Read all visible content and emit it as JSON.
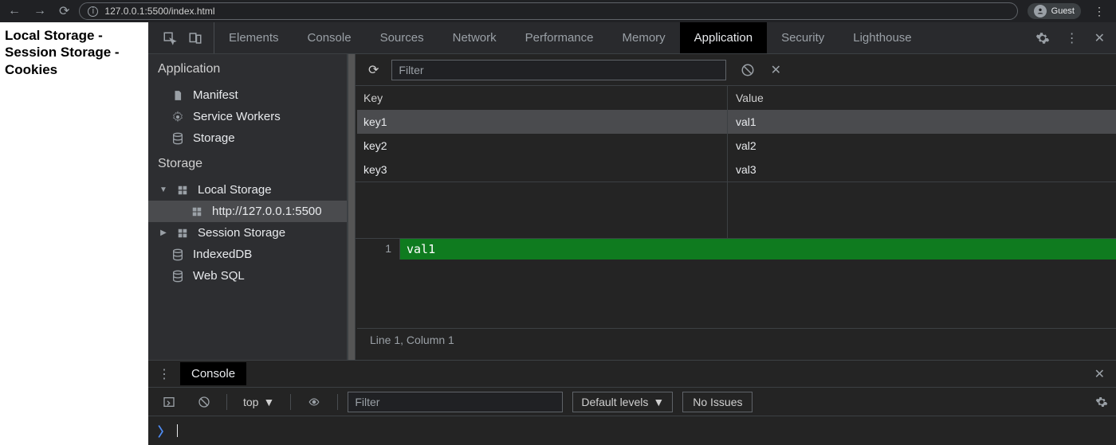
{
  "chrome": {
    "url": "127.0.0.1:5500/index.html",
    "guest": "Guest"
  },
  "page": {
    "line1": "Local Storage -",
    "line2": "Session Storage -",
    "line3": "Cookies"
  },
  "devtools": {
    "tabs": [
      "Elements",
      "Console",
      "Sources",
      "Network",
      "Performance",
      "Memory",
      "Application",
      "Security",
      "Lighthouse"
    ],
    "active_tab": "Application"
  },
  "sidebar": {
    "section1": "Application",
    "items1": {
      "manifest": "Manifest",
      "sw": "Service Workers",
      "storage": "Storage"
    },
    "section2": "Storage",
    "items2": {
      "local": "Local Storage",
      "local_origin": "http://127.0.0.1:5500",
      "session": "Session Storage",
      "indexeddb": "IndexedDB",
      "websql": "Web SQL"
    }
  },
  "main": {
    "filter_placeholder": "Filter",
    "headers": {
      "key": "Key",
      "value": "Value"
    },
    "rows": [
      {
        "k": "key1",
        "v": "val1"
      },
      {
        "k": "key2",
        "v": "val2"
      },
      {
        "k": "key3",
        "v": "val3"
      }
    ],
    "preview": {
      "line_no": "1",
      "value": "val1"
    },
    "status": "Line 1, Column 1"
  },
  "console": {
    "title": "Console",
    "context": "top",
    "filter_placeholder": "Filter",
    "levels": "Default levels",
    "issues": "No Issues"
  }
}
